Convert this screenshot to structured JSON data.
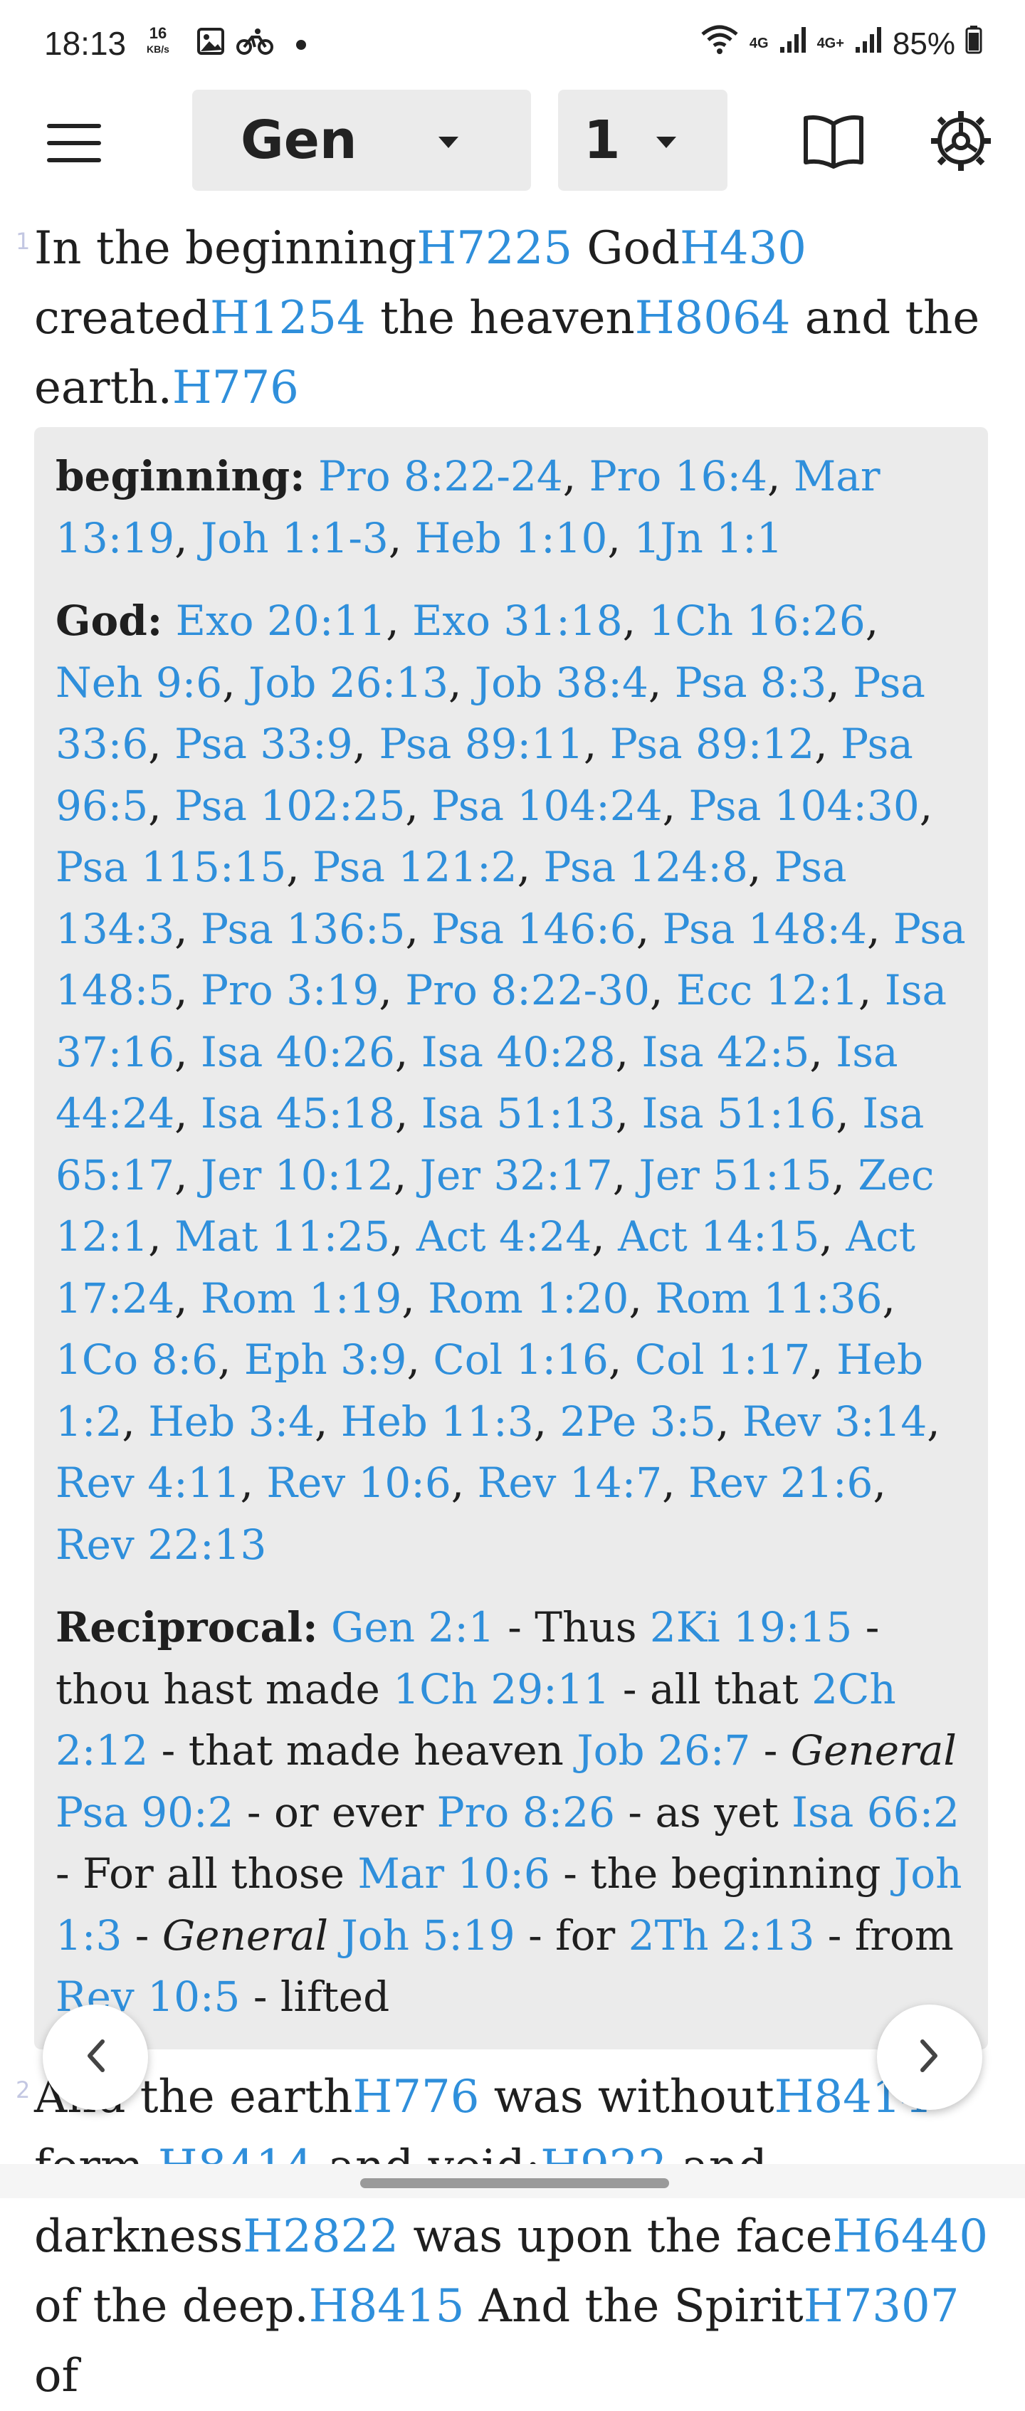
{
  "status": {
    "time": "18:13",
    "speed_value": "16",
    "speed_unit": "KB/s",
    "network1": "4G",
    "network2": "4G+",
    "battery": "85%"
  },
  "toolbar": {
    "book": "Gen",
    "chapter": "1"
  },
  "verse1": {
    "number": "1",
    "segments": [
      {
        "t": "In the beginning",
        "link": false
      },
      {
        "t": "H7225",
        "link": true
      },
      {
        "t": " God",
        "link": false
      },
      {
        "t": "H430",
        "link": true
      },
      {
        "t": " created",
        "link": false
      },
      {
        "t": "H1254",
        "link": true
      },
      {
        "t": " the heaven",
        "link": false
      },
      {
        "t": "H8064",
        "link": true
      },
      {
        "t": " and the earth.",
        "link": false
      },
      {
        "t": "H776",
        "link": true
      }
    ]
  },
  "xrefs": [
    {
      "key": "beginning:",
      "items": [
        {
          "t": "Pro 8:22-24",
          "type": "link"
        },
        {
          "t": "Pro 16:4",
          "type": "link"
        },
        {
          "t": "Mar 13:19",
          "type": "link"
        },
        {
          "t": "Joh 1:1-3",
          "type": "link"
        },
        {
          "t": "Heb 1:10",
          "type": "link"
        },
        {
          "t": "1Jn 1:1",
          "type": "link"
        }
      ],
      "sep": ", "
    },
    {
      "key": "God:",
      "items": [
        {
          "t": "Exo 20:11",
          "type": "link"
        },
        {
          "t": "Exo 31:18",
          "type": "link"
        },
        {
          "t": "1Ch 16:26",
          "type": "link"
        },
        {
          "t": "Neh 9:6",
          "type": "link"
        },
        {
          "t": "Job 26:13",
          "type": "link"
        },
        {
          "t": "Job 38:4",
          "type": "link"
        },
        {
          "t": "Psa 8:3",
          "type": "link"
        },
        {
          "t": "Psa 33:6",
          "type": "link"
        },
        {
          "t": "Psa 33:9",
          "type": "link"
        },
        {
          "t": "Psa 89:11",
          "type": "link"
        },
        {
          "t": "Psa 89:12",
          "type": "link"
        },
        {
          "t": "Psa 96:5",
          "type": "link"
        },
        {
          "t": "Psa 102:25",
          "type": "link"
        },
        {
          "t": "Psa 104:24",
          "type": "link"
        },
        {
          "t": "Psa 104:30",
          "type": "link"
        },
        {
          "t": "Psa 115:15",
          "type": "link"
        },
        {
          "t": "Psa 121:2",
          "type": "link"
        },
        {
          "t": "Psa 124:8",
          "type": "link"
        },
        {
          "t": "Psa 134:3",
          "type": "link"
        },
        {
          "t": "Psa 136:5",
          "type": "link"
        },
        {
          "t": "Psa 146:6",
          "type": "link"
        },
        {
          "t": "Psa 148:4",
          "type": "link"
        },
        {
          "t": "Psa 148:5",
          "type": "link"
        },
        {
          "t": "Pro 3:19",
          "type": "link"
        },
        {
          "t": "Pro 8:22-30",
          "type": "link"
        },
        {
          "t": "Ecc 12:1",
          "type": "link"
        },
        {
          "t": "Isa 37:16",
          "type": "link"
        },
        {
          "t": "Isa 40:26",
          "type": "link"
        },
        {
          "t": "Isa 40:28",
          "type": "link"
        },
        {
          "t": "Isa 42:5",
          "type": "link"
        },
        {
          "t": "Isa 44:24",
          "type": "link"
        },
        {
          "t": "Isa 45:18",
          "type": "link"
        },
        {
          "t": "Isa 51:13",
          "type": "link"
        },
        {
          "t": "Isa 51:16",
          "type": "link"
        },
        {
          "t": "Isa 65:17",
          "type": "link"
        },
        {
          "t": "Jer 10:12",
          "type": "link"
        },
        {
          "t": "Jer 32:17",
          "type": "link"
        },
        {
          "t": "Jer 51:15",
          "type": "link"
        },
        {
          "t": "Zec 12:1",
          "type": "link"
        },
        {
          "t": "Mat 11:25",
          "type": "link"
        },
        {
          "t": "Act 4:24",
          "type": "link"
        },
        {
          "t": "Act 14:15",
          "type": "link"
        },
        {
          "t": "Act 17:24",
          "type": "link"
        },
        {
          "t": "Rom 1:19",
          "type": "link"
        },
        {
          "t": "Rom 1:20",
          "type": "link"
        },
        {
          "t": "Rom 11:36",
          "type": "link"
        },
        {
          "t": "1Co 8:6",
          "type": "link"
        },
        {
          "t": "Eph 3:9",
          "type": "link"
        },
        {
          "t": "Col 1:16",
          "type": "link"
        },
        {
          "t": "Col 1:17",
          "type": "link"
        },
        {
          "t": "Heb 1:2",
          "type": "link"
        },
        {
          "t": "Heb 3:4",
          "type": "link"
        },
        {
          "t": "Heb 11:3",
          "type": "link"
        },
        {
          "t": "2Pe 3:5",
          "type": "link"
        },
        {
          "t": "Rev 3:14",
          "type": "link"
        },
        {
          "t": "Rev 4:11",
          "type": "link"
        },
        {
          "t": "Rev 10:6",
          "type": "link"
        },
        {
          "t": "Rev 14:7",
          "type": "link"
        },
        {
          "t": "Rev 21:6",
          "type": "link"
        },
        {
          "t": "Rev 22:13",
          "type": "link"
        }
      ],
      "sep": ", "
    },
    {
      "key": "Reciprocal:",
      "items": [
        {
          "t": "Gen 2:1",
          "type": "link"
        },
        {
          "t": " - Thus ",
          "type": "text"
        },
        {
          "t": "2Ki 19:15",
          "type": "link"
        },
        {
          "t": " - thou hast made ",
          "type": "text"
        },
        {
          "t": "1Ch 29:11",
          "type": "link"
        },
        {
          "t": " - all that ",
          "type": "text"
        },
        {
          "t": "2Ch 2:12",
          "type": "link"
        },
        {
          "t": " - that made heaven ",
          "type": "text"
        },
        {
          "t": "Job 26:7",
          "type": "link"
        },
        {
          "t": " - ",
          "type": "text"
        },
        {
          "t": "General",
          "type": "ital"
        },
        {
          "t": " ",
          "type": "text"
        },
        {
          "t": "Psa 90:2",
          "type": "link"
        },
        {
          "t": " - or ever ",
          "type": "text"
        },
        {
          "t": "Pro 8:26",
          "type": "link"
        },
        {
          "t": " - as yet ",
          "type": "text"
        },
        {
          "t": "Isa 66:2",
          "type": "link"
        },
        {
          "t": " - For all those ",
          "type": "text"
        },
        {
          "t": "Mar 10:6",
          "type": "link"
        },
        {
          "t": " - the beginning ",
          "type": "text"
        },
        {
          "t": "Joh 1:3",
          "type": "link"
        },
        {
          "t": " - ",
          "type": "text"
        },
        {
          "t": "General",
          "type": "ital"
        },
        {
          "t": " ",
          "type": "text"
        },
        {
          "t": "Joh 5:19",
          "type": "link"
        },
        {
          "t": " - for ",
          "type": "text"
        },
        {
          "t": "2Th 2:13",
          "type": "link"
        },
        {
          "t": " - from ",
          "type": "text"
        },
        {
          "t": "Rev 10:5",
          "type": "link"
        },
        {
          "t": " - lifted",
          "type": "text"
        }
      ],
      "sep": ""
    }
  ],
  "verse2": {
    "number": "2",
    "segments": [
      {
        "t": "And the earth",
        "link": false
      },
      {
        "t": "H776",
        "link": true
      },
      {
        "t": " was without",
        "link": false
      },
      {
        "t": "H8414",
        "link": true
      },
      {
        "t": " form,",
        "link": false
      },
      {
        "t": "H8414",
        "link": true
      },
      {
        "t": " and void;",
        "link": false
      },
      {
        "t": "H922",
        "link": true
      },
      {
        "t": " and darkness",
        "link": false
      },
      {
        "t": "H2822",
        "link": true
      },
      {
        "t": " was upon the face",
        "link": false
      },
      {
        "t": "H6440",
        "link": true
      },
      {
        "t": " of the deep.",
        "link": false
      },
      {
        "t": "H8415",
        "link": true
      },
      {
        "t": " And the Spirit",
        "link": false
      },
      {
        "t": "H7307",
        "link": true
      },
      {
        "t": " of",
        "link": false
      }
    ]
  },
  "icons": {
    "menu": "menu-icon",
    "book_caret": "chevron-down-icon",
    "parallel": "open-book-icon",
    "settings": "settings-icon",
    "prev": "chevron-left-icon",
    "next": "chevron-right-icon"
  },
  "colors": {
    "link": "#2f8fdb",
    "panel": "#ebebeb",
    "verse_number": "#c3c7e2"
  }
}
